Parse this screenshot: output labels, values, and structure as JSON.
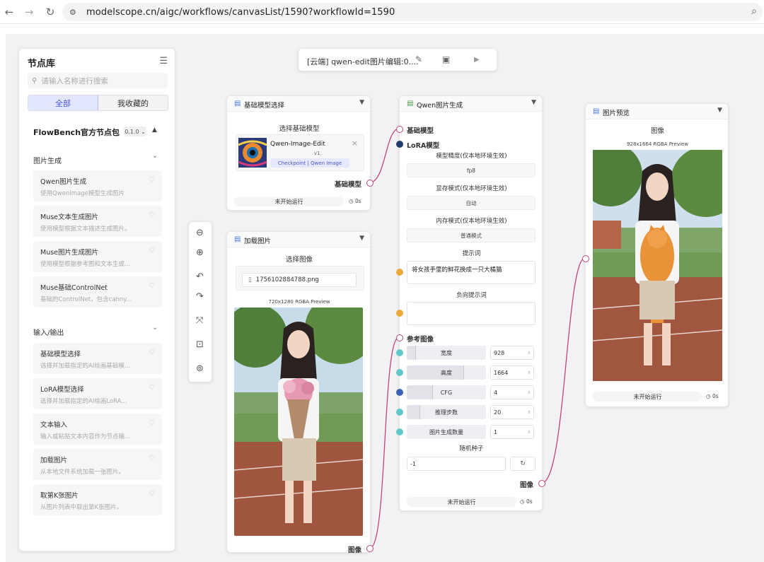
{
  "browser": {
    "url": "modelscope.cn/aigc/workflows/canvasList/1590?workflowId=1590"
  },
  "sidebar": {
    "title": "节点库",
    "search_placeholder": "请输入名称进行搜索",
    "tabs": [
      {
        "label": "全部",
        "active": true
      },
      {
        "label": "我收藏的",
        "active": false
      }
    ],
    "package": "FlowBench官方节点包",
    "version": "0.1.0",
    "sections": [
      {
        "title": "图片生成",
        "items": [
          {
            "title": "Qwen图片生成",
            "desc": "使用QwenImage模型生成图片"
          },
          {
            "title": "Muse文本生成图片",
            "desc": "使用模型根据文本描述生成图片。"
          },
          {
            "title": "Muse图片生成图片",
            "desc": "使用模型根据参考图和文本生成..."
          },
          {
            "title": "Muse基础ControlNet",
            "desc": "基础的ControlNet，包含canny..."
          }
        ]
      },
      {
        "title": "输入/输出",
        "items": [
          {
            "title": "基础模型选择",
            "desc": "选择并加载指定的AI绘画基础模..."
          },
          {
            "title": "LoRA模型选择",
            "desc": "选择并加载指定的AI绘画LoRA..."
          },
          {
            "title": "文本输入",
            "desc": "输入或粘贴文本内容作为节点输..."
          },
          {
            "title": "加载图片",
            "desc": "从本地文件系统加载一张图片。"
          },
          {
            "title": "取第K张图片",
            "desc": "从图片列表中取出第K张图片。"
          }
        ]
      }
    ]
  },
  "toolbar": {
    "title": "[云端] qwen-edit图片编辑:0...."
  },
  "node_base_model": {
    "title": "基础模型选择",
    "section": "选择基础模型",
    "model_name": "Qwen-Image-Edit",
    "model_version": "v1",
    "model_tag": "Checkpoint | Qwen Image",
    "output_label": "基础模型",
    "status": "未开始运行",
    "time": "0s"
  },
  "node_load_image": {
    "title": "加载图片",
    "section": "选择图像",
    "filename": "1756102884788.png",
    "preview": "720x1280 RGBA Preview",
    "output_label": "图像"
  },
  "node_qwen": {
    "title": "Qwen图片生成",
    "input_base": "基础模型",
    "input_lora": "LoRA模型",
    "precision_label": "模型精度(仅本地环境生效)",
    "precision_value": "fp8",
    "vram_label": "显存模式(仅本地环境生效)",
    "vram_value": "自动",
    "memory_label": "内存模式(仅本地环境生效)",
    "memory_value": "普通模式",
    "prompt_label": "提示词",
    "prompt_value": "将女孩手里的鲜花换成一只大橘猫",
    "neg_label": "负向提示词",
    "neg_value": "",
    "ref_label": "参考图像",
    "params": [
      {
        "name": "宽度",
        "value": "928",
        "fill": 0.12
      },
      {
        "name": "高度",
        "value": "1664",
        "fill": 0.72
      },
      {
        "name": "CFG",
        "value": "4",
        "fill": 0.33
      },
      {
        "name": "推理步数",
        "value": "20",
        "fill": 0.17
      },
      {
        "name": "图片生成数量",
        "value": "1",
        "fill": 0.0
      }
    ],
    "seed_label": "随机种子",
    "seed_value": "-1",
    "output_label": "图像",
    "status": "未开始运行",
    "time": "0s"
  },
  "node_preview": {
    "title": "图片预览",
    "section": "图像",
    "preview": "928x1664 RGBA Preview",
    "status": "未开始运行",
    "time": "0s"
  },
  "colors": {
    "accent": "#4b55d8",
    "edge": "#c2447a"
  }
}
